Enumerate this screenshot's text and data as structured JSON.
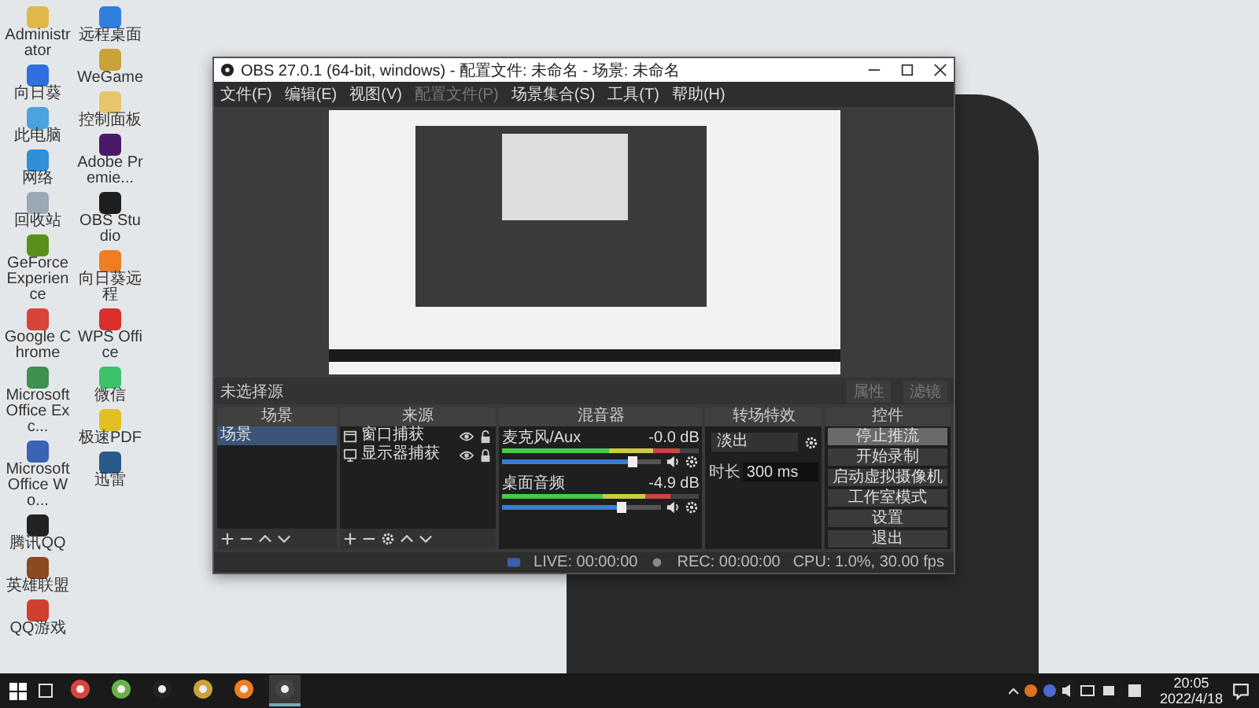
{
  "desktop": {
    "icon_columns": [
      [
        {
          "label": "Administrator",
          "color": "#e0b84a"
        },
        {
          "label": "向日葵",
          "color": "#2f6fe0"
        },
        {
          "label": "此电脑",
          "color": "#4aa3df"
        },
        {
          "label": "网络",
          "color": "#2f8fd8"
        },
        {
          "label": "回收站",
          "color": "#9aa7b4"
        },
        {
          "label": "GeForce Experience",
          "color": "#5a8f1c"
        },
        {
          "label": "Google Chrome",
          "color": "#d9443a"
        },
        {
          "label": "Microsoft Office Exc...",
          "color": "#3f8f4f"
        },
        {
          "label": "Microsoft Office Wo...",
          "color": "#3b63b5"
        },
        {
          "label": "腾讯QQ",
          "color": "#222222"
        },
        {
          "label": "英雄联盟",
          "color": "#8a4a22"
        },
        {
          "label": "QQ游戏",
          "color": "#d04030"
        }
      ],
      [
        {
          "label": "远程桌面",
          "color": "#2f7fe0"
        },
        {
          "label": "WeGame",
          "color": "#c9a23a"
        },
        {
          "label": "控制面板",
          "color": "#e8c46a"
        },
        {
          "label": "Adobe Premie...",
          "color": "#4a1a6a"
        },
        {
          "label": "OBS Studio",
          "color": "#1e1e1e"
        },
        {
          "label": "向日葵远程",
          "color": "#ef7d22"
        },
        {
          "label": "WPS Office",
          "color": "#d8302a"
        },
        {
          "label": "微信",
          "color": "#3cc36a"
        },
        {
          "label": "极速PDF",
          "color": "#e0c020"
        },
        {
          "label": "迅雷",
          "color": "#2a5a8a"
        }
      ]
    ]
  },
  "window": {
    "title": "OBS 27.0.1 (64-bit, windows) - 配置文件: 未命名 - 场景: 未命名",
    "menu": [
      {
        "label": "文件(F)",
        "disabled": false
      },
      {
        "label": "编辑(E)",
        "disabled": false
      },
      {
        "label": "视图(V)",
        "disabled": false
      },
      {
        "label": "配置文件(P)",
        "disabled": true
      },
      {
        "label": "场景集合(S)",
        "disabled": false
      },
      {
        "label": "工具(T)",
        "disabled": false
      },
      {
        "label": "帮助(H)",
        "disabled": false
      }
    ],
    "source_toolbar": {
      "label": "未选择源",
      "buttons": [
        {
          "label": "属性",
          "disabled": true
        },
        {
          "label": "滤镜",
          "disabled": true
        }
      ]
    },
    "scenes": {
      "title": "场景",
      "items": [
        {
          "label": "场景",
          "selected": true
        }
      ]
    },
    "sources": {
      "title": "来源",
      "items": [
        {
          "label": "窗口捕获",
          "kind": "window",
          "visible": true,
          "locked": false
        },
        {
          "label": "显示器捕获",
          "kind": "display",
          "visible": true,
          "locked": true
        }
      ]
    },
    "mixer": {
      "title": "混音器",
      "channels": [
        {
          "name": "麦克风/Aux",
          "reading": "-0.0 dB",
          "meter": {
            "level": 0.9
          },
          "volume": {
            "level": 0.82
          },
          "muted": false
        },
        {
          "name": "桌面音频",
          "reading": "-4.9 dB",
          "meter": {
            "level": 0.85
          },
          "volume": {
            "level": 0.75
          },
          "muted": false
        }
      ]
    },
    "transitions": {
      "title": "转场特效",
      "transition": "淡出",
      "duration_label": "时长",
      "duration": "300 ms"
    },
    "controls": {
      "title": "控件",
      "buttons": [
        {
          "label": "停止推流",
          "active": true
        },
        {
          "label": "开始录制",
          "active": false
        },
        {
          "label": "启动虚拟摄像机",
          "active": false
        },
        {
          "label": "工作室模式",
          "active": false
        },
        {
          "label": "设置",
          "active": false
        },
        {
          "label": "退出",
          "active": false
        }
      ]
    },
    "status_bar": {
      "live": "LIVE: 00:00:00",
      "rec": "REC: 00:00:00",
      "cpu": "CPU: 1.0%, 30.00 fps"
    }
  },
  "taskbar": {
    "apps": [
      {
        "kind": "chrome",
        "active": false
      },
      {
        "kind": "browser360",
        "active": false
      },
      {
        "kind": "qq",
        "active": false
      },
      {
        "kind": "wegame",
        "active": false
      },
      {
        "kind": "orange",
        "active": false
      },
      {
        "kind": "obs",
        "active": true
      }
    ],
    "time": "20:05",
    "date": "2022/4/18"
  }
}
